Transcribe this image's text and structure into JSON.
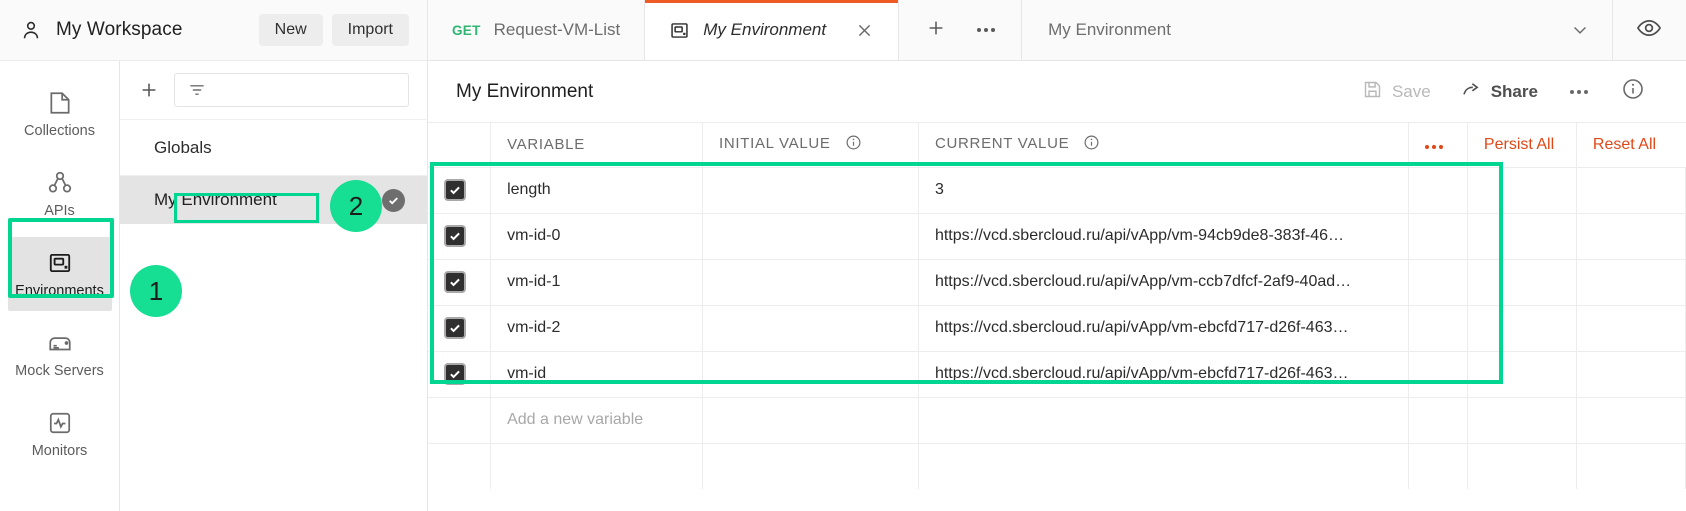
{
  "workspace": {
    "title": "My Workspace",
    "user_icon": "user-icon",
    "new_label": "New",
    "import_label": "Import"
  },
  "sidebar": {
    "items": [
      {
        "label": "Collections",
        "icon": "collections-icon",
        "active": false
      },
      {
        "label": "APIs",
        "icon": "apis-icon",
        "active": false
      },
      {
        "label": "Environments",
        "icon": "environments-icon",
        "active": true
      },
      {
        "label": "Mock Servers",
        "icon": "mock-servers-icon",
        "active": false
      },
      {
        "label": "Monitors",
        "icon": "monitors-icon",
        "active": false
      }
    ]
  },
  "env_list": {
    "add_icon": "plus-icon",
    "filter_icon": "filter-icon",
    "filter_placeholder": "",
    "filter_value": "",
    "globals_label": "Globals",
    "selected_env": "My Environment",
    "active_check_icon": "check-circle-icon"
  },
  "annotations": {
    "badge_1": "1",
    "badge_2": "2",
    "highlight_color": "#00d68f"
  },
  "tabs": {
    "request_tab": {
      "method": "GET",
      "name": "Request-VM-List"
    },
    "env_tab": {
      "name": "My Environment",
      "icon": "environment-icon",
      "close_icon": "close-icon"
    },
    "new_tab_icon": "plus-icon",
    "more_icon": "ellipsis-icon"
  },
  "env_selector": {
    "selected": "My Environment",
    "chevron_icon": "chevron-down-icon",
    "eye_icon": "eye-icon"
  },
  "env_header": {
    "title": "My Environment",
    "save_label": "Save",
    "save_icon": "save-icon",
    "share_label": "Share",
    "share_icon": "share-icon",
    "more_icon": "ellipsis-icon",
    "info_icon": "info-icon"
  },
  "variables_table": {
    "columns": {
      "variable": "VARIABLE",
      "initial_value": "INITIAL VALUE",
      "current_value": "CURRENT VALUE",
      "info_icon": "info-icon",
      "bulk_edit_icon": "ellipsis-icon"
    },
    "actions": {
      "persist_all": "Persist All",
      "reset_all": "Reset All"
    },
    "rows": [
      {
        "checked": true,
        "variable": "length",
        "initial_value": "",
        "current_value": "3"
      },
      {
        "checked": true,
        "variable": "vm-id-0",
        "initial_value": "",
        "current_value": "https://vcd.sbercloud.ru/api/vApp/vm-94cb9de8-383f-46…"
      },
      {
        "checked": true,
        "variable": "vm-id-1",
        "initial_value": "",
        "current_value": "https://vcd.sbercloud.ru/api/vApp/vm-ccb7dfcf-2af9-40ad…"
      },
      {
        "checked": true,
        "variable": "vm-id-2",
        "initial_value": "",
        "current_value": "https://vcd.sbercloud.ru/api/vApp/vm-ebcfd717-d26f-463…"
      },
      {
        "checked": true,
        "variable": "vm-id",
        "initial_value": "",
        "current_value": "https://vcd.sbercloud.ru/api/vApp/vm-ebcfd717-d26f-463…"
      }
    ],
    "add_new_placeholder": "Add a new variable"
  }
}
